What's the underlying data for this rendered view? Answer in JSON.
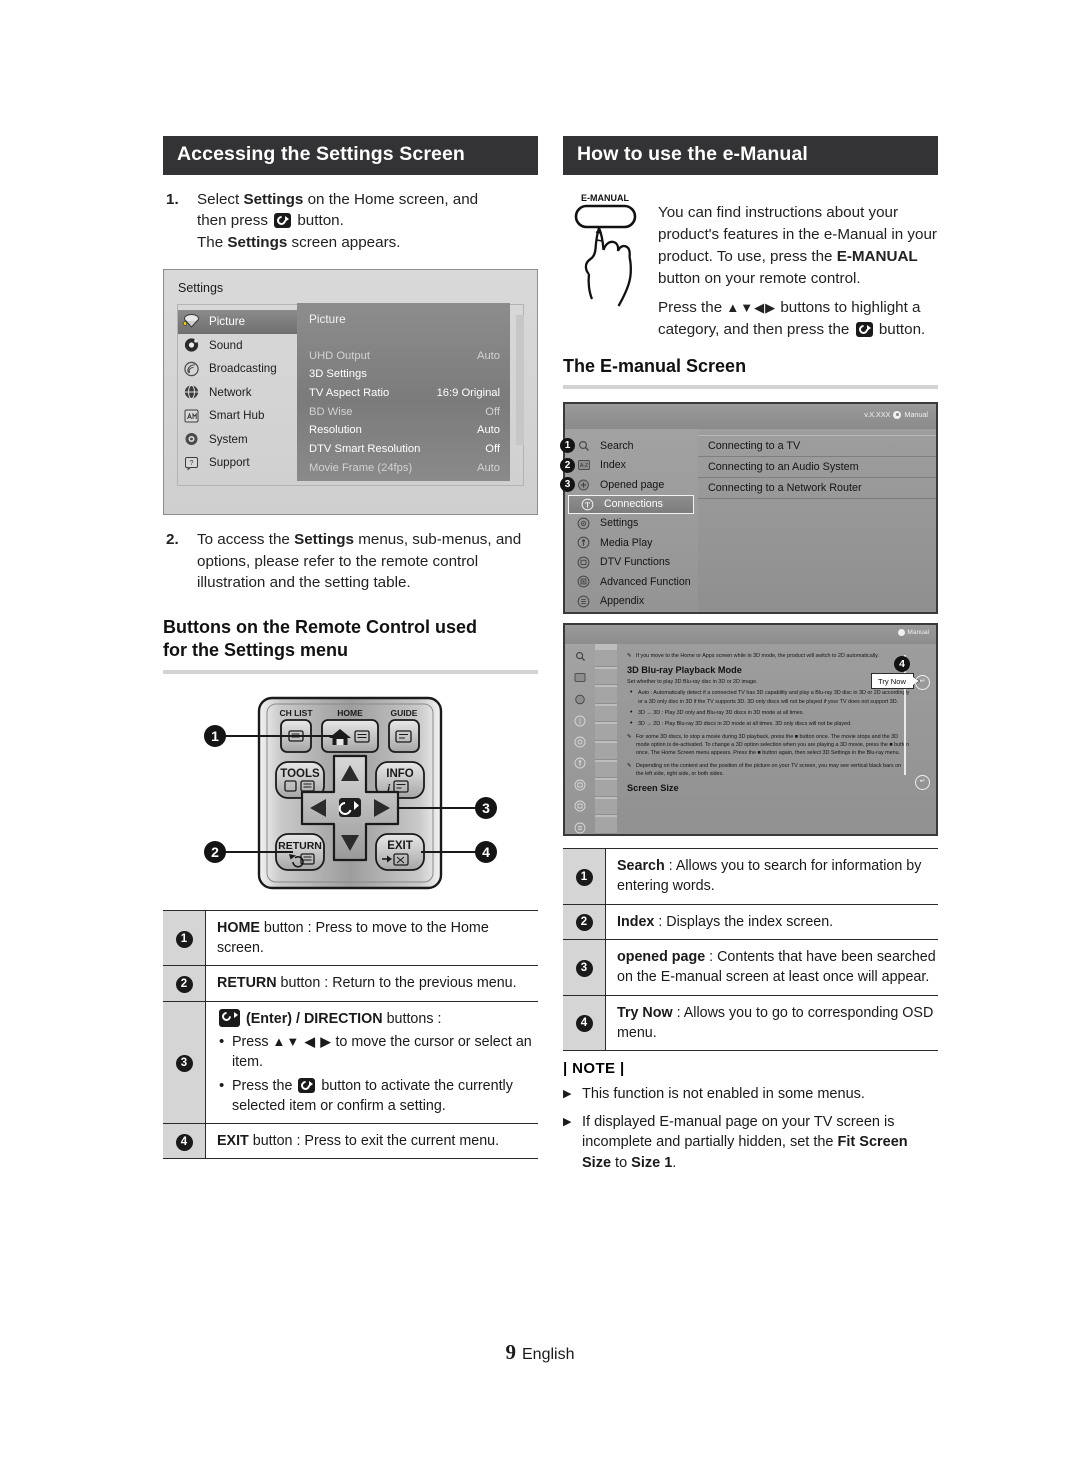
{
  "document": {
    "footer_page_number": "9",
    "footer_language": "English"
  },
  "left_column": {
    "section_title": "Accessing the Settings Screen",
    "steps": [
      {
        "number": "1.",
        "line1_a": "Select ",
        "line1_b": "Settings",
        "line1_c": " on the Home screen, and",
        "line2_a": "then press ",
        "line2_c": " button.",
        "line3_a": "The ",
        "line3_b": "Settings",
        "line3_c": " screen appears."
      },
      {
        "number": "2.",
        "text_a": "To access the ",
        "text_b": "Settings",
        "text_c": " menus, sub-menus, and options, please refer to the remote control illustration and the setting table."
      }
    ],
    "settings_osd": {
      "title": "Settings",
      "menu_items": [
        {
          "label": "Picture",
          "icon": "picture-icon",
          "selected": true
        },
        {
          "label": "Sound",
          "icon": "sound-icon",
          "selected": false
        },
        {
          "label": "Broadcasting",
          "icon": "broadcasting-icon",
          "selected": false
        },
        {
          "label": "Network",
          "icon": "network-icon",
          "selected": false
        },
        {
          "label": "Smart Hub",
          "icon": "smart-hub-icon",
          "selected": false
        },
        {
          "label": "System",
          "icon": "system-icon",
          "selected": false
        },
        {
          "label": "Support",
          "icon": "support-icon",
          "selected": false
        }
      ],
      "panel_title": "Picture",
      "panel_rows": [
        {
          "label": "UHD Output",
          "value": "Auto",
          "state": "off"
        },
        {
          "label": "3D Settings",
          "value": "",
          "state": "on"
        },
        {
          "label": "TV Aspect Ratio",
          "value": "16:9 Original",
          "state": "on"
        },
        {
          "label": "BD Wise",
          "value": "Off",
          "state": "off"
        },
        {
          "label": "Resolution",
          "value": "Auto",
          "state": "on"
        },
        {
          "label": "DTV Smart Resolution",
          "value": "Off",
          "state": "on"
        },
        {
          "label": "Movie Frame (24fps)",
          "value": "Auto",
          "state": "off"
        }
      ]
    },
    "remote_heading_line1": "Buttons on the Remote Control used",
    "remote_heading_line2": "for the Settings menu",
    "remote": {
      "ch_list_label": "CH LIST",
      "home_label": "HOME",
      "guide_label": "GUIDE",
      "tools_label": "TOOLS",
      "info_label": "INFO",
      "return_label": "RETURN",
      "exit_label": "EXIT",
      "callouts": [
        "1",
        "2",
        "3",
        "4"
      ]
    },
    "button_table": [
      {
        "num": "1",
        "bold": "HOME",
        "rest": " button : Press to move to the Home screen."
      },
      {
        "num": "2",
        "bold": "RETURN",
        "rest": " button : Return to the previous menu."
      },
      {
        "num": "3",
        "header_bold": "(Enter) / DIRECTION",
        "header_rest": " buttons :",
        "bullets": [
          {
            "pre": "Press ",
            "arrows": "▲▼ ◀ ▶",
            "post": " to move the cursor or select an item."
          },
          {
            "pre": "Press the ",
            "post": " button to activate the currently selected item or confirm a setting."
          }
        ]
      },
      {
        "num": "4",
        "bold": "EXIT",
        "rest": " button : Press to exit the current menu."
      }
    ]
  },
  "right_column": {
    "section_title": "How to use the e-Manual",
    "emanual_button_label": "E-MANUAL",
    "intro_paragraph_1": {
      "a": "You can find instructions about your product's features in the e-Manual in your product. To use, press the ",
      "b": "E-MANUAL",
      "c": " button on your remote control."
    },
    "intro_paragraph_2": {
      "a": "Press the ",
      "arrows": "▲▼◀▶",
      "b": " buttons to highlight a category, and then press the ",
      "c": " button."
    },
    "emanual_screen_heading": "The E-manual Screen",
    "emanual_screen": {
      "version_text": "v.X.XXX",
      "logo_text": "Manual",
      "menu_items": [
        {
          "label": "Search",
          "badge": "1",
          "icon": "search-icon",
          "selected": false
        },
        {
          "label": "Index",
          "badge": "2",
          "icon": "index-icon",
          "selected": false
        },
        {
          "label": "Opened page",
          "badge": "3",
          "icon": "opened-page-icon",
          "selected": false
        },
        {
          "label": "Connections",
          "badge": "",
          "icon": "connections-icon",
          "selected": true
        },
        {
          "label": "Settings",
          "badge": "",
          "icon": "settings-icon",
          "selected": false
        },
        {
          "label": "Media Play",
          "badge": "",
          "icon": "media-play-icon",
          "selected": false
        },
        {
          "label": "DTV Functions",
          "badge": "",
          "icon": "dtv-functions-icon",
          "selected": false
        },
        {
          "label": "Advanced Function",
          "badge": "",
          "icon": "advanced-function-icon",
          "selected": false
        },
        {
          "label": "Appendix",
          "badge": "",
          "icon": "appendix-icon",
          "selected": false
        }
      ],
      "articles": [
        "Connecting to a TV",
        "Connecting to an Audio System",
        "Connecting to a Network Router"
      ]
    },
    "emanual_detail_screen": {
      "logo_text": "Manual",
      "top_note": "If you move to the Home or Apps screen while in 3D mode, the product will switch to 2D automatically.",
      "heading": "3D Blu-ray Playback Mode",
      "subtext": "Set whether to play 3D Blu-ray disc in 3D or 2D image.",
      "bullets": [
        "Auto : Automatically detect if a connected TV has 3D capability and play a Blu-ray 3D disc in 3D or 2D accordingly or a 3D only disc in 3D if the TV supports 3D. 3D only discs will not be played if your TV does not support 3D.",
        "3D → 3D : Play 3D only and Blu-ray 3D discs in 3D mode at all times.",
        "3D → 2D : Play Blu-ray 3D discs in 2D mode at all times. 3D only discs will not be played."
      ],
      "notes": [
        "For some 3D discs, to stop a movie during 3D playback, press the ■ button once. The movie stops and the 3D mode option is de-activated. To change a 3D option selection when you are playing a 3D movie, press the ■ button once. The Home Screen menu appears. Press the ■ button again, then select 3D Settings in the Blu-ray menu.",
        "Depending on the content and the position of the picture on your TV screen, you may see vertical black bars on the left side, right side, or both sides."
      ],
      "footer_heading": "Screen Size",
      "try_now_label": "Try Now",
      "callout_badge": "4"
    },
    "feature_table": [
      {
        "num": "1",
        "bold": "Search",
        "rest": " : Allows you to search for information by entering words."
      },
      {
        "num": "2",
        "bold": "Index",
        "rest": " : Displays the index screen."
      },
      {
        "num": "3",
        "bold": "opened page",
        "rest": " : Contents that have been searched on the E-manual screen at least once will appear."
      },
      {
        "num": "4",
        "bold": "Try Now",
        "rest": " : Allows you to go to corresponding OSD menu."
      }
    ],
    "note": {
      "title": "| NOTE |",
      "items": [
        {
          "text": "This function is not enabled in some menus."
        },
        {
          "a": "If displayed E-manual page on your TV screen is incomplete and partially hidden, set the ",
          "b": "Fit Screen Size",
          "c": " to ",
          "d": "Size 1",
          "e": "."
        }
      ]
    }
  }
}
